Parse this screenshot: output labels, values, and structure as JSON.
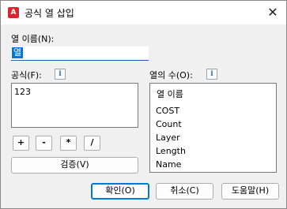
{
  "window": {
    "title": "공식 열 삽입",
    "close_glyph": "✕",
    "app_icon_letter": "A"
  },
  "column_name": {
    "label": "열 이름(N):",
    "value": "열"
  },
  "formula": {
    "label": "공식(F):",
    "value": "123",
    "info": "i",
    "operators": [
      "+",
      "-",
      "*",
      "/"
    ],
    "verify_label": "검증(V)"
  },
  "columns": {
    "label": "열의 수(O):",
    "info": "i",
    "items": [
      "열 이름",
      "COST",
      "Count",
      "Layer",
      "Length",
      "Name"
    ]
  },
  "buttons": {
    "ok": "확인(O)",
    "cancel": "취소(C)",
    "help": "도움말(H)"
  },
  "colors": {
    "accent": "#0078d7",
    "app_icon": "#d9262c"
  }
}
